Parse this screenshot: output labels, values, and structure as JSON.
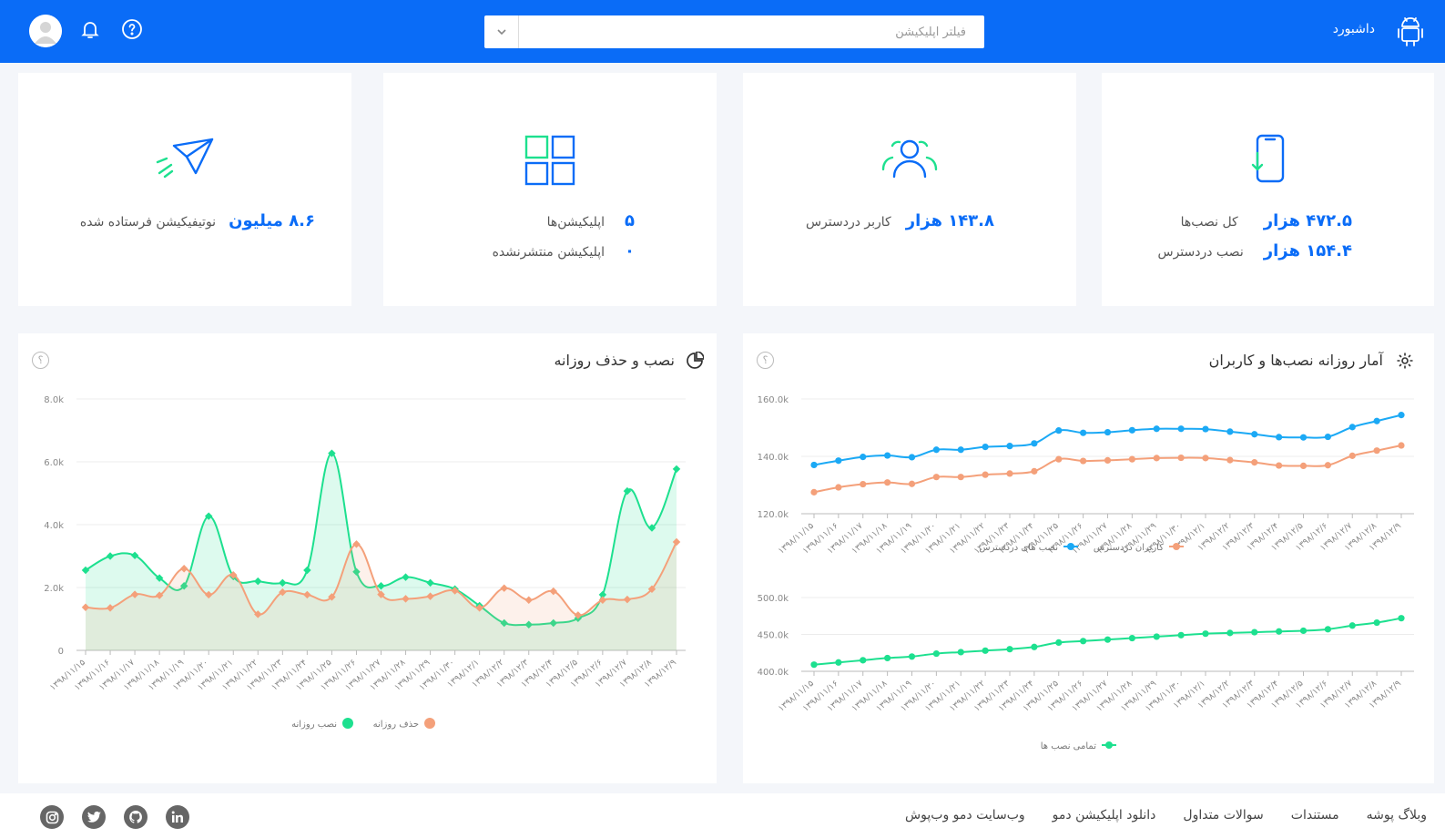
{
  "header": {
    "title": "داشبورد",
    "search_placeholder": "فیلتر اپلیکیشن"
  },
  "stats": {
    "installs": {
      "total_value": "۴۷۲.۵ هزار",
      "total_label": "کل نصب‌ها",
      "active_value": "۱۵۴.۴ هزار",
      "active_label": "نصب دردسترس"
    },
    "users": {
      "value": "۱۴۳.۸ هزار",
      "label": "کاربر دردسترس"
    },
    "apps": {
      "count": "۵",
      "count_label": "اپلیکیشن‌ها",
      "unpublished": "۰",
      "unpublished_label": "اپلیکیشن منتشرنشده"
    },
    "notifications": {
      "value": "۸.۶ میلیون",
      "label": "نوتیفیکیشن فرستاده شده"
    }
  },
  "panels": {
    "daily_stats_title": "آمار روزانه نصب‌ها و کاربران",
    "daily_install_remove_title": "نصب و حذف روزانه",
    "help_glyph": "؟"
  },
  "colors": {
    "primary": "#0a6cf7",
    "green": "#1de08f",
    "orange": "#f4a07a",
    "blue_line": "#1ba9f5"
  },
  "chart_data": [
    {
      "type": "line",
      "title": "نصب و حذف روزانه",
      "x": [
        "۱۳۹۸/۱۱/۱۵",
        "۱۳۹۸/۱۱/۱۶",
        "۱۳۹۸/۱۱/۱۷",
        "۱۳۹۸/۱۱/۱۸",
        "۱۳۹۸/۱۱/۱۹",
        "۱۳۹۸/۱۱/۲۰",
        "۱۳۹۸/۱۱/۲۱",
        "۱۳۹۸/۱۱/۲۲",
        "۱۳۹۸/۱۱/۲۳",
        "۱۳۹۸/۱۱/۲۴",
        "۱۳۹۸/۱۱/۲۵",
        "۱۳۹۸/۱۱/۲۶",
        "۱۳۹۸/۱۱/۲۷",
        "۱۳۹۸/۱۱/۲۸",
        "۱۳۹۸/۱۱/۲۹",
        "۱۳۹۸/۱۱/۳۰",
        "۱۳۹۸/۱۲/۱",
        "۱۳۹۸/۱۲/۲",
        "۱۳۹۸/۱۲/۳",
        "۱۳۹۸/۱۲/۴",
        "۱۳۹۸/۱۲/۵",
        "۱۳۹۸/۱۲/۶",
        "۱۳۹۸/۱۲/۷",
        "۱۳۹۸/۱۲/۸",
        "۱۳۹۸/۱۲/۹"
      ],
      "ylim": [
        0,
        8000
      ],
      "yticks": [
        "0",
        "2.0k",
        "4.0k",
        "6.0k",
        "8.0k"
      ],
      "series": [
        {
          "name": "نصب روزانه",
          "color": "#1de08f",
          "values": [
            2550,
            3000,
            3020,
            2300,
            2050,
            4270,
            2350,
            2200,
            2150,
            2550,
            6270,
            2500,
            2050,
            2330,
            2150,
            1950,
            1420,
            870,
            820,
            870,
            1020,
            1770,
            5070,
            3900,
            5770
          ]
        },
        {
          "name": "حذف روزانه",
          "color": "#f4a07a",
          "values": [
            1370,
            1350,
            1780,
            1750,
            2600,
            1770,
            2400,
            1150,
            1850,
            1770,
            1700,
            3380,
            1780,
            1640,
            1720,
            1900,
            1350,
            1980,
            1600,
            1880,
            1120,
            1600,
            1620,
            1950,
            3450
          ]
        }
      ],
      "legend": "bottom"
    },
    {
      "type": "line",
      "title": "آمار روزانه نصب‌ها و کاربران",
      "x": [
        "۱۳۹۸/۱۱/۱۵",
        "۱۳۹۸/۱۱/۱۶",
        "۱۳۹۸/۱۱/۱۷",
        "۱۳۹۸/۱۱/۱۸",
        "۱۳۹۸/۱۱/۱۹",
        "۱۳۹۸/۱۱/۲۰",
        "۱۳۹۸/۱۱/۲۱",
        "۱۳۹۸/۱۱/۲۲",
        "۱۳۹۸/۱۱/۲۳",
        "۱۳۹۸/۱۱/۲۴",
        "۱۳۹۸/۱۱/۲۵",
        "۱۳۹۸/۱۱/۲۶",
        "۱۳۹۸/۱۱/۲۷",
        "۱۳۹۸/۱۱/۲۸",
        "۱۳۹۸/۱۱/۲۹",
        "۱۳۹۸/۱۱/۳۰",
        "۱۳۹۸/۱۲/۱",
        "۱۳۹۸/۱۲/۲",
        "۱۳۹۸/۱۲/۳",
        "۱۳۹۸/۱۲/۴",
        "۱۳۹۸/۱۲/۵",
        "۱۳۹۸/۱۲/۶",
        "۱۳۹۸/۱۲/۷",
        "۱۳۹۸/۱۲/۸",
        "۱۳۹۸/۱۲/۹"
      ],
      "ylim": [
        120000,
        160000
      ],
      "yticks": [
        "120.0k",
        "140.0k",
        "160.0k"
      ],
      "series": [
        {
          "name": "نصب های دردسترس",
          "color": "#1ba9f5",
          "values": [
            137000,
            138500,
            139800,
            140300,
            139700,
            142300,
            142300,
            143300,
            143600,
            144500,
            149000,
            148200,
            148400,
            149100,
            149600,
            149600,
            149500,
            148600,
            147700,
            146700,
            146600,
            146800,
            150200,
            152300,
            154400
          ]
        },
        {
          "name": "کاربران دردسترس",
          "color": "#f4a07a",
          "values": [
            127500,
            129200,
            130300,
            130900,
            130400,
            132800,
            132800,
            133600,
            134000,
            134800,
            139000,
            138400,
            138600,
            139000,
            139400,
            139500,
            139400,
            138700,
            137900,
            136800,
            136700,
            136900,
            140200,
            142000,
            143800
          ]
        }
      ],
      "legend": "bottom"
    },
    {
      "type": "line",
      "x": [
        "۱۳۹۸/۱۱/۱۵",
        "۱۳۹۸/۱۱/۱۶",
        "۱۳۹۸/۱۱/۱۷",
        "۱۳۹۸/۱۱/۱۸",
        "۱۳۹۸/۱۱/۱۹",
        "۱۳۹۸/۱۱/۲۰",
        "۱۳۹۸/۱۱/۲۱",
        "۱۳۹۸/۱۱/۲۲",
        "۱۳۹۸/۱۱/۲۳",
        "۱۳۹۸/۱۱/۲۴",
        "۱۳۹۸/۱۱/۲۵",
        "۱۳۹۸/۱۱/۲۶",
        "۱۳۹۸/۱۱/۲۷",
        "۱۳۹۸/۱۱/۲۸",
        "۱۳۹۸/۱۱/۲۹",
        "۱۳۹۸/۱۱/۳۰",
        "۱۳۹۸/۱۲/۱",
        "۱۳۹۸/۱۲/۲",
        "۱۳۹۸/۱۲/۳",
        "۱۳۹۸/۱۲/۴",
        "۱۳۹۸/۱۲/۵",
        "۱۳۹۸/۱۲/۶",
        "۱۳۹۸/۱۲/۷",
        "۱۳۹۸/۱۲/۸",
        "۱۳۹۸/۱۲/۹"
      ],
      "ylim": [
        400000,
        500000
      ],
      "yticks": [
        "400.0k",
        "450.0k",
        "500.0k"
      ],
      "series": [
        {
          "name": "تمامی نصب ها",
          "color": "#1de08f",
          "values": [
            409000,
            412000,
            415000,
            418000,
            420000,
            424000,
            426000,
            428000,
            430000,
            433000,
            439000,
            441000,
            443000,
            445000,
            447000,
            449000,
            451000,
            452000,
            453000,
            454000,
            455000,
            457000,
            462000,
            466000,
            472000
          ]
        }
      ],
      "legend": "bottom"
    }
  ],
  "footer": {
    "links": [
      "وبلاگ پوشه",
      "مستندات",
      "سوالات متداول",
      "دانلود اپلیکیشن دمو",
      "وب‌سایت دمو وب‌پوش"
    ]
  }
}
